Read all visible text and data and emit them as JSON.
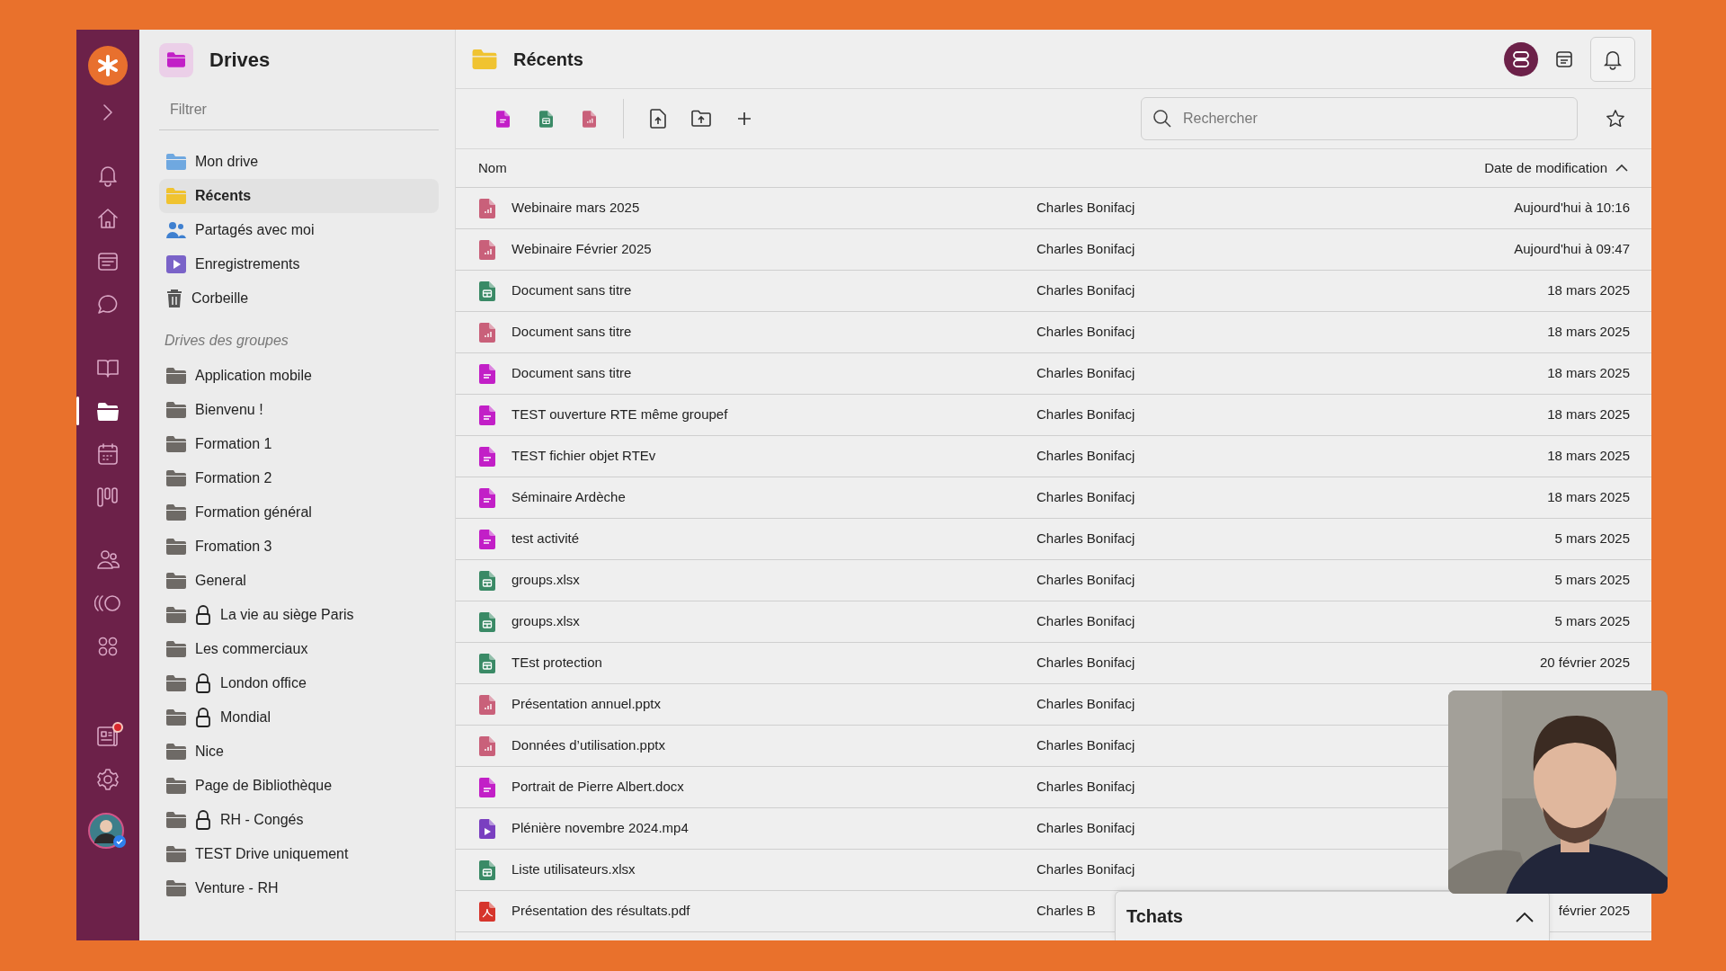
{
  "rail": {
    "items": [
      {
        "kind": "logo",
        "selected": false,
        "notification": false
      },
      {
        "kind": "expand",
        "selected": false,
        "notification": false
      },
      {
        "kind": "bell",
        "selected": false,
        "notification": false
      },
      {
        "kind": "home",
        "selected": false,
        "notification": false
      },
      {
        "kind": "news",
        "selected": false,
        "notification": false
      },
      {
        "kind": "chat",
        "selected": false,
        "notification": false
      },
      {
        "kind": "book",
        "selected": false,
        "notification": false
      },
      {
        "kind": "folder",
        "selected": true,
        "notification": false
      },
      {
        "kind": "calendar",
        "selected": false,
        "notification": false
      },
      {
        "kind": "kanban",
        "selected": false,
        "notification": false
      },
      {
        "kind": "people",
        "selected": false,
        "notification": false
      },
      {
        "kind": "waves",
        "selected": false,
        "notification": false
      },
      {
        "kind": "apps",
        "selected": false,
        "notification": false
      },
      {
        "kind": "board",
        "selected": false,
        "notification": true
      },
      {
        "kind": "settings",
        "selected": false,
        "notification": false
      },
      {
        "kind": "avatar",
        "selected": false,
        "notification": false
      }
    ]
  },
  "sidebar": {
    "title": "Drives",
    "filter": {
      "placeholder": "Filtrer"
    },
    "items": [
      {
        "label": "Mon drive",
        "kind": "drive",
        "selected": false
      },
      {
        "label": "Récents",
        "kind": "recent",
        "selected": true
      },
      {
        "label": "Partagés avec moi",
        "kind": "shared",
        "selected": false
      },
      {
        "label": "Enregistrements",
        "kind": "recordings",
        "selected": false
      },
      {
        "label": "Corbeille",
        "kind": "trash",
        "selected": false
      }
    ],
    "groups_heading": "Drives des groupes",
    "groups": [
      {
        "label": "Application mobile",
        "locked": false
      },
      {
        "label": "Bienvenu !",
        "locked": false
      },
      {
        "label": "Formation 1",
        "locked": false
      },
      {
        "label": "Formation 2",
        "locked": false
      },
      {
        "label": "Formation général",
        "locked": false
      },
      {
        "label": "Fromation 3",
        "locked": false
      },
      {
        "label": "General",
        "locked": false
      },
      {
        "label": "La vie au siège Paris",
        "locked": true
      },
      {
        "label": "Les commerciaux",
        "locked": false
      },
      {
        "label": "London office",
        "locked": true
      },
      {
        "label": "Mondial",
        "locked": true
      },
      {
        "label": "Nice",
        "locked": false
      },
      {
        "label": "Page de Bibliothèque",
        "locked": false
      },
      {
        "label": "RH - Congés",
        "locked": true
      },
      {
        "label": "TEST Drive uniquement",
        "locked": false
      },
      {
        "label": "Venture - RH",
        "locked": false
      }
    ]
  },
  "main": {
    "title": "Récents",
    "search": {
      "placeholder": "Rechercher"
    },
    "columns": [
      {
        "label": "Nom"
      },
      {
        "label": "Date de modification",
        "sort_ascending": true
      }
    ],
    "rows": [
      {
        "name": "Webinaire mars 2025",
        "kind": "slides",
        "author": "Charles Bonifacj",
        "date": "Aujourd'hui à 10:16"
      },
      {
        "name": "Webinaire Février 2025",
        "kind": "slides",
        "author": "Charles Bonifacj",
        "date": "Aujourd'hui à 09:47"
      },
      {
        "name": "Document sans titre",
        "kind": "sheet",
        "author": "Charles Bonifacj",
        "date": "18 mars 2025"
      },
      {
        "name": "Document sans titre",
        "kind": "slides",
        "author": "Charles Bonifacj",
        "date": "18 mars 2025"
      },
      {
        "name": "Document sans titre",
        "kind": "doc",
        "author": "Charles Bonifacj",
        "date": "18 mars 2025"
      },
      {
        "name": "TEST ouverture RTE même groupef",
        "kind": "doc",
        "author": "Charles Bonifacj",
        "date": "18 mars 2025"
      },
      {
        "name": "TEST fichier objet RTEv",
        "kind": "doc",
        "author": "Charles Bonifacj",
        "date": "18 mars 2025"
      },
      {
        "name": "Séminaire Ardèche",
        "kind": "doc",
        "author": "Charles Bonifacj",
        "date": "18 mars 2025"
      },
      {
        "name": "test activité",
        "kind": "doc",
        "author": "Charles Bonifacj",
        "date": "5 mars 2025"
      },
      {
        "name": "groups.xlsx",
        "kind": "sheet",
        "author": "Charles Bonifacj",
        "date": "5 mars 2025"
      },
      {
        "name": "groups.xlsx",
        "kind": "sheet",
        "author": "Charles Bonifacj",
        "date": "5 mars 2025"
      },
      {
        "name": "TEst protection",
        "kind": "sheet",
        "author": "Charles Bonifacj",
        "date": "20 février 2025"
      },
      {
        "name": "Présentation annuel.pptx",
        "kind": "slides",
        "author": "Charles Bonifacj"
      },
      {
        "name": "Données d’utilisation.pptx",
        "kind": "slides",
        "author": "Charles Bonifacj"
      },
      {
        "name": "Portrait de Pierre Albert.docx",
        "kind": "doc",
        "author": "Charles Bonifacj"
      },
      {
        "name": "Plénière novembre 2024.mp4",
        "kind": "video",
        "author": "Charles Bonifacj"
      },
      {
        "name": "Liste utilisateurs.xlsx",
        "kind": "sheet",
        "author": "Charles Bonifacj"
      },
      {
        "name": "Présentation des résultats.pdf",
        "kind": "pdf",
        "author": "Charles B",
        "date": "février 2025"
      }
    ]
  },
  "chats": {
    "title": "Tchats",
    "expanded": false
  }
}
